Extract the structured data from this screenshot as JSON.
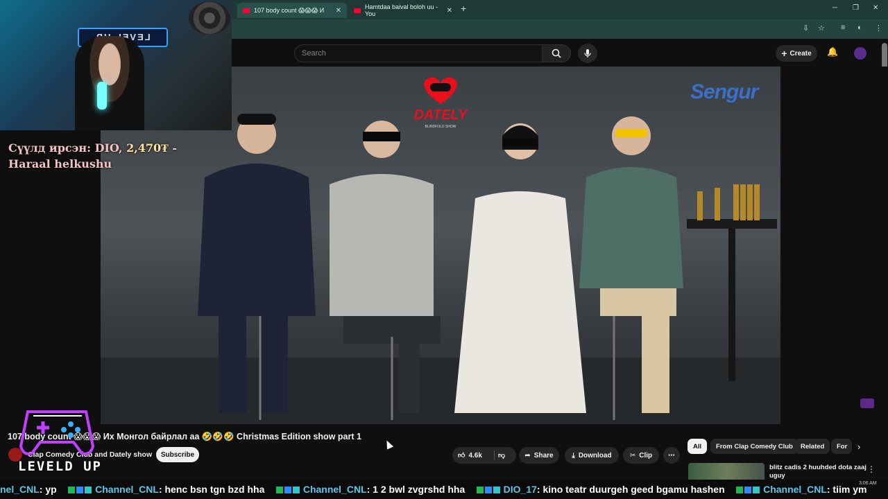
{
  "browser": {
    "tabs": [
      {
        "title": "107 body count 😱😱😱 И",
        "active": true
      },
      {
        "title": "Hamtdaa baival boloh uu - You",
        "active": false
      }
    ],
    "new_tab_icon": "plus-icon",
    "window_controls": [
      "─",
      "❐",
      "✕"
    ]
  },
  "youtube": {
    "search_placeholder": "Search",
    "create_label": "Create",
    "video": {
      "title": "107 body count 😱😱😱 Их Монгол байрлал аа 🤣🤣🤣 Christmas Edition show part 1",
      "channel": "Clap Comedy Club and Dately show",
      "subscribe_label": "Subscribe",
      "likes": "4.6k",
      "share_label": "Share",
      "download_label": "Download",
      "clip_label": "Clip",
      "logo_dately": "DATELY",
      "logo_dately_sub": "BLINDFOLD SHOW",
      "logo_sengur": "Sengur"
    },
    "chips": [
      "All",
      "From Clap Comedy Club",
      "Related",
      "For"
    ],
    "recommendation": {
      "title": "blitz cadis 2 huuhded dota zaaj uguy"
    }
  },
  "stream_overlay": {
    "donation_prefix": "Сүүлд ирсэн: DIO, ",
    "donation_amount": "2,470₮",
    "donation_suffix": " -",
    "donation_name": "Haraal helkushu",
    "logo_text": "LEVELD UP",
    "webcam_sign": "LEVEL UP",
    "clock": "3:06 AM"
  },
  "chat_ticker": [
    {
      "user": "nel_CNL",
      "msg": ": yp"
    },
    {
      "user": "Channel_CNL",
      "msg": ": henc bsn tgn bzd hha"
    },
    {
      "user": "Channel_CNL",
      "msg": ": 1 2 bwl zvgrshd hha"
    },
    {
      "user": "DIO_17",
      "msg": ": kino teatr duurgeh geed bgamu hashen"
    },
    {
      "user": "Channel_CNL",
      "msg": ": tiim ym"
    }
  ],
  "colors": {
    "accent_red": "#ff0033",
    "tab_bar": "#1f3a36",
    "ticker_user": "#5fc6e6"
  }
}
